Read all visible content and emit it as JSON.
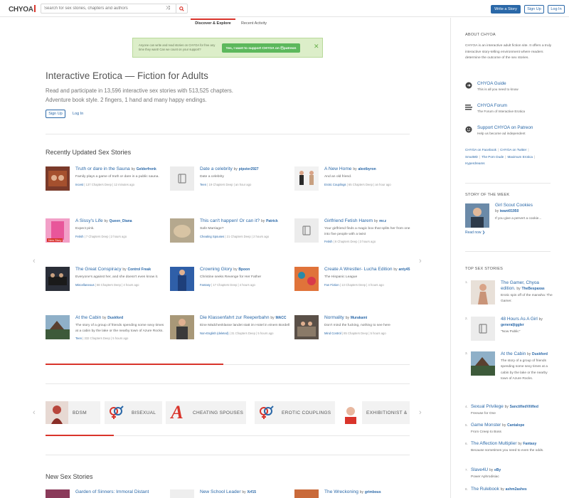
{
  "header": {
    "logo": "CHYOA",
    "search_placeholder": "Search for sex stories, chapters and authors",
    "write_label": "Write a Story",
    "signup_label": "Sign Up",
    "login_label": "Log In"
  },
  "tabs": [
    {
      "label": "Discover & Explore"
    },
    {
      "label": "Recent Activity"
    }
  ],
  "patreon": {
    "text": "Anyone can write and read stories on CHYOA for free any time they want! Can we count on your support?",
    "button": "Yes, I want to support CHYOA on Ⓟpatreon"
  },
  "hero": {
    "title": "Interactive Erotica — Fiction for Adults",
    "subtitle": "Read and participate in 13,596 interactive sex stories with 513,525 chapters. Adventure book style. 2 fingers, 1 hand and many happy endings.",
    "signup": "Sign Up",
    "login": "Log In"
  },
  "recent": {
    "title": "Recently Updated Sex Stories",
    "stories": [
      {
        "title": "Truth or dare in the Sauna",
        "author": "Gelderfrenk",
        "desc": "Family plays a game of truth or dare in a public sauna.",
        "tag": "Incest",
        "meta": "137 Chapters Deep | 12 minutes ago"
      },
      {
        "title": "Date a celebrity",
        "author": "pipster2927",
        "desc": "Date a celebrity",
        "tag": "Teen",
        "meta": "19 Chapters Deep | an hour ago"
      },
      {
        "title": "A New Home",
        "author": "alextbyron",
        "desc": "And an old friend.",
        "tag": "Erotic Couplings",
        "meta": "65 Chapters Deep | an hour ago"
      },
      {
        "title": "A Sissy's Life",
        "author": "Queen_Diana",
        "desc": "Expect pink.",
        "tag": "Fetish",
        "meta": "7 Chapters Deep | 2 hours ago",
        "badge": "New Story"
      },
      {
        "title": "This can't happen! Or can it?",
        "author": "Patrick",
        "desc": "Safe Marriage?",
        "tag": "Cheating Spouses",
        "meta": "21 Chapters Deep | 2 hours ago"
      },
      {
        "title": "Girlfriend Fetish Harem",
        "author": "mr.z",
        "desc": "Your girlfriend finds a magic box that splits her from one into five people with a twist",
        "tag": "Fetish",
        "meta": "6 Chapters Deep | 3 hours ago"
      },
      {
        "title": "The Great Conspiracy",
        "author": "Control Freak",
        "desc": "Everyone's against her, and she doesn't even know it.",
        "tag": "Miscellaneous",
        "meta": "68 Chapters Deep | 4 hours ago"
      },
      {
        "title": "Crowning Glory",
        "author": "Bpoon",
        "desc": "Christine seeks Revenge for Her Father",
        "tag": "Fantasy",
        "meta": "17 Chapters Deep | 4 hours ago"
      },
      {
        "title": "Create A Wrestler- Lucha Edition",
        "author": "anty45",
        "desc": "The Hispanic League",
        "tag": "Fan Fiction",
        "meta": "13 Chapters Deep | 4 hours ago"
      },
      {
        "title": "At the Cabin",
        "author": "Duskford",
        "desc": "The story of a group of friends spending some sexy times at a cabin by the lake or the nearby town of Azure Rocks.",
        "tag": "Teen",
        "meta": "332 Chapters Deep | 5 hours ago"
      },
      {
        "title": "Die Klassenfahrt zur Reeperbahn",
        "author": "MACC",
        "desc": "Eine Mädchenklasse landet statt im Hotel in einem Bordell",
        "tag": "Non-English (deleted)",
        "meta": "31 Chapters Deep | 5 hours ago"
      },
      {
        "title": "Normality",
        "author": "Murakami",
        "desc": "Don't mind the fucking, nothing to see here",
        "tag": "Mind Control",
        "meta": "85 Chapters Deep | 5 hours ago"
      }
    ]
  },
  "categories": [
    {
      "label": "BDSM"
    },
    {
      "label": "BISEXUAL"
    },
    {
      "label": "CHEATING SPOUSES"
    },
    {
      "label": "EROTIC COUPLINGS"
    },
    {
      "label": "EXHIBITIONIST &"
    }
  ],
  "new_stories": {
    "title": "New Sex Stories",
    "items": [
      {
        "title": "Garden of Sinners: Immoral Distant"
      },
      {
        "title": "New School Leader",
        "author": "Xrf15"
      },
      {
        "title": "The Wreckoning",
        "author": "grimbous"
      }
    ]
  },
  "sidebar": {
    "about_title": "ABOUT CHYOA",
    "about_text": "CHYOA is an interactive adult fiction site. It offers a truly interactive story-telling environment where readers determine the outcome of the sex stories.",
    "links": [
      {
        "title": "CHYOA Guide",
        "sub": "This is all you need to know"
      },
      {
        "title": "CHYOA Forum",
        "sub": "The Forum of Interactive Erotica"
      },
      {
        "title": "Support CHYOA on Patreon",
        "sub": "Help us become ad independent"
      }
    ],
    "social": [
      "CHYOA on Facebook",
      "CHYOA on Twitter",
      "SmutMD",
      "The Porn Dude",
      "Maximum Erotica",
      "Hyperdreams"
    ],
    "sotw_title": "STORY OF THE WEEK",
    "sotw": {
      "title": "Girl Scout Cookies",
      "author": "iwant01950",
      "desc": "If you give a pervert a cookie...",
      "read_more": "Read now ❯"
    },
    "top_title": "TOP SEX STORIES",
    "top": [
      {
        "num": "1.",
        "title": "The Gamer, Chyoa edition.",
        "author": "TheBespaxas",
        "desc": "Erotic spin off of the manwha: The Gamer."
      },
      {
        "num": "2.",
        "title": "48 Hours As A Girl",
        "author": "generaljiggler",
        "desc": "\"Now Public\""
      },
      {
        "num": "3.",
        "title": "At the Cabin",
        "author": "Duskford",
        "desc": "The story of a group of friends spending some sexy times at a cabin by the lake or the nearby town of Azure Rocks."
      },
      {
        "num": "4.",
        "title": "Sexual Privilege",
        "author": "SanctifiedVilified",
        "desc": "Freeuse for One"
      },
      {
        "num": "5.",
        "title": "Game Monster",
        "author": "Cantalope",
        "desc": "From Creep to Boss"
      },
      {
        "num": "6.",
        "title": "The Affection Multiplier",
        "author": "Fantasy",
        "desc": "Because sometimes you need to even the odds."
      },
      {
        "num": "7.",
        "title": "Slave4U",
        "author": "eBy",
        "desc": "Power Aphrodisiac"
      },
      {
        "num": "8.",
        "title": "The Rulebook",
        "author": "ashm2ashes",
        "desc": ""
      }
    ]
  },
  "colors": {
    "accent": "#d9342b",
    "link": "#2a68a8",
    "patreon_bg": "#dceec9",
    "patreon_btn": "#5cb85c"
  }
}
